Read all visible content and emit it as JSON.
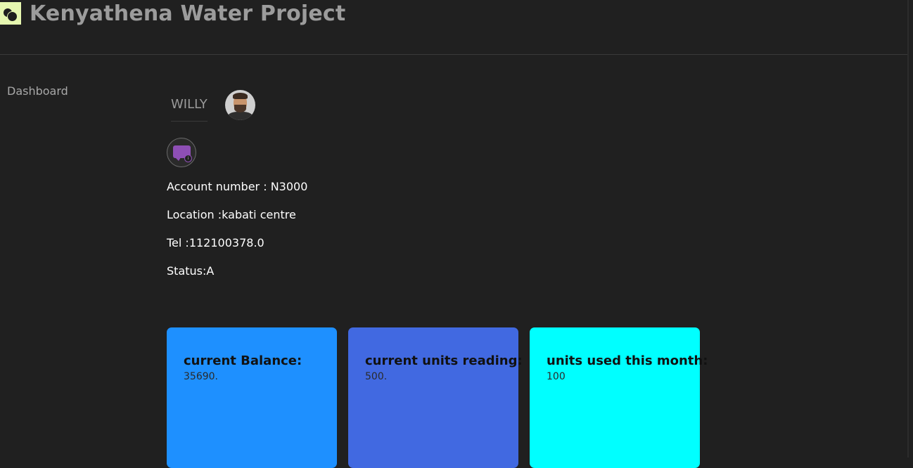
{
  "app": {
    "title": "Kenyathena Water Project"
  },
  "sidebar": {
    "items": [
      {
        "label": "Dashboard"
      }
    ]
  },
  "user": {
    "name": "WILLY"
  },
  "icons": {
    "logo": "app-logo-icon",
    "message": "message-icon",
    "avatar": "user-avatar"
  },
  "account": {
    "account_number": "Account number : N3000",
    "location": "Location :kabati centre",
    "tel": "Tel :112100378.0",
    "status": "Status:A"
  },
  "cards": [
    {
      "label": "current Balance:",
      "value": "35690.",
      "color": "#1e90ff"
    },
    {
      "label": "current units reading:",
      "value": "500.",
      "color": "#4169e1"
    },
    {
      "label": "units used this month:",
      "value": "100",
      "color": "#00ffff"
    }
  ],
  "colors": {
    "background": "#202020",
    "logo_bg": "#e6f7b0",
    "message_icon": "#8e4fb5"
  }
}
